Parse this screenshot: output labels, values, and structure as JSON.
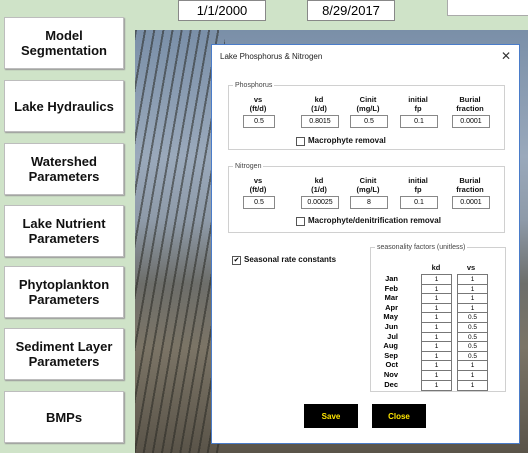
{
  "dates": {
    "start": "1/1/2000",
    "end": "8/29/2017"
  },
  "nav": [
    {
      "label": "Model\nSegmentation",
      "name": "nav-model-segmentation"
    },
    {
      "label": "Lake Hydraulics",
      "name": "nav-lake-hydraulics"
    },
    {
      "label": "Watershed\nParameters",
      "name": "nav-watershed-parameters"
    },
    {
      "label": "Lake Nutrient\nParameters",
      "name": "nav-lake-nutrient-parameters"
    },
    {
      "label": "Phytoplankton\nParameters",
      "name": "nav-phytoplankton-parameters"
    },
    {
      "label": "Sediment Layer\nParameters",
      "name": "nav-sediment-layer-parameters"
    },
    {
      "label": "BMPs",
      "name": "nav-bmps"
    }
  ],
  "dialog": {
    "title": "Lake Phosphorus & Nitrogen",
    "close_glyph": "✕",
    "phosphorus": {
      "legend": "Phosphorus",
      "headers": [
        "vs\n(ft/d)",
        "kd\n(1/d)",
        "Cinit\n(mg/L)",
        "initial\nfp",
        "Burial\nfraction"
      ],
      "values": [
        "0.5",
        "0.8015",
        "0.5",
        "0.1",
        "0.0001"
      ],
      "checkbox_label": "Macrophyte removal"
    },
    "nitrogen": {
      "legend": "Nitrogen",
      "headers": [
        "vs\n(ft/d)",
        "kd\n(1/d)",
        "Cinit\n(mg/L)",
        "initial\nfp",
        "Burial\nfraction"
      ],
      "values": [
        "0.5",
        "0.00025",
        "8",
        "0.1",
        "0.0001"
      ],
      "checkbox_label": "Macrophyte/denitrification removal"
    },
    "seasonal": {
      "checkbox_label": "Seasonal rate constants",
      "checkbox_mark": "✔",
      "legend": "seasonality factors (unitless)",
      "col_kd": "kd",
      "col_vs": "vs",
      "months": [
        "Jan",
        "Feb",
        "Mar",
        "Apr",
        "May",
        "Jun",
        "Jul",
        "Aug",
        "Sep",
        "Oct",
        "Nov",
        "Dec"
      ],
      "kd": [
        "1",
        "1",
        "1",
        "1",
        "1",
        "1",
        "1",
        "1",
        "1",
        "1",
        "1",
        "1"
      ],
      "vs": [
        "1",
        "1",
        "1",
        "1",
        "0.5",
        "0.5",
        "0.5",
        "0.5",
        "0.5",
        "1",
        "1",
        "1"
      ]
    },
    "save_label": "Save",
    "close_label": "Close"
  }
}
